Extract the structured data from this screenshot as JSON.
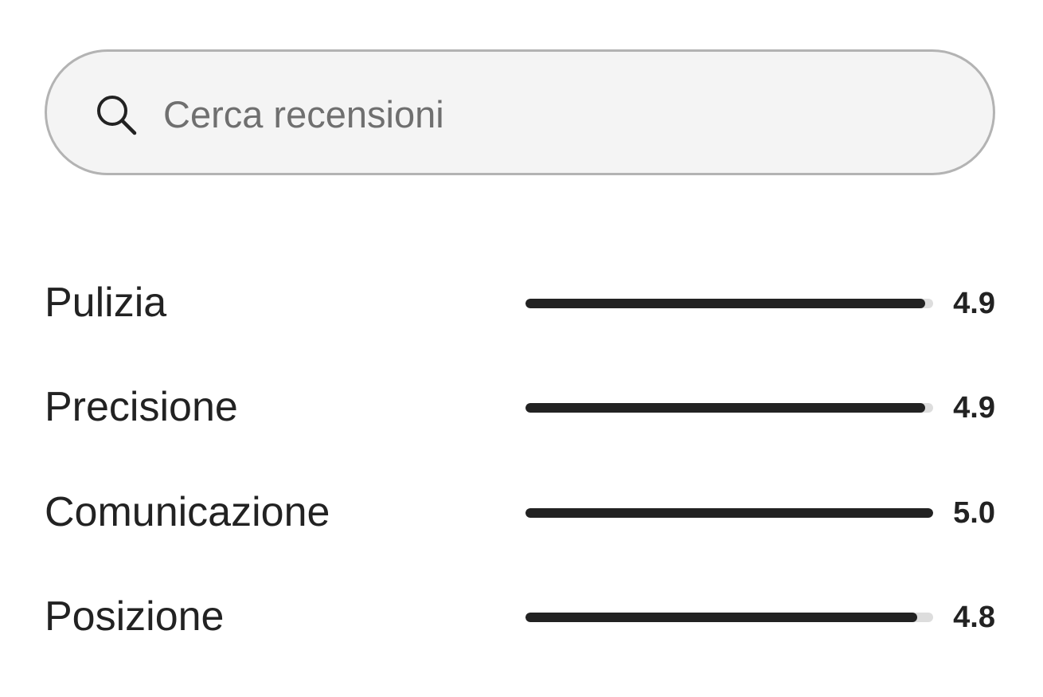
{
  "search": {
    "placeholder": "Cerca recensioni",
    "value": ""
  },
  "ratings": {
    "max": 5,
    "items": [
      {
        "label": "Pulizia",
        "value": "4.9",
        "fill": 0.98
      },
      {
        "label": "Precisione",
        "value": "4.9",
        "fill": 0.98
      },
      {
        "label": "Comunicazione",
        "value": "5.0",
        "fill": 1.0
      },
      {
        "label": "Posizione",
        "value": "4.8",
        "fill": 0.96
      }
    ]
  },
  "colors": {
    "text": "#222222",
    "bar_fill": "#222222",
    "bar_track": "#dddddd",
    "search_bg": "#f4f4f4",
    "search_border": "#b3b3b3",
    "placeholder": "#6f6f6f"
  },
  "icons": {
    "search": "search-icon"
  }
}
